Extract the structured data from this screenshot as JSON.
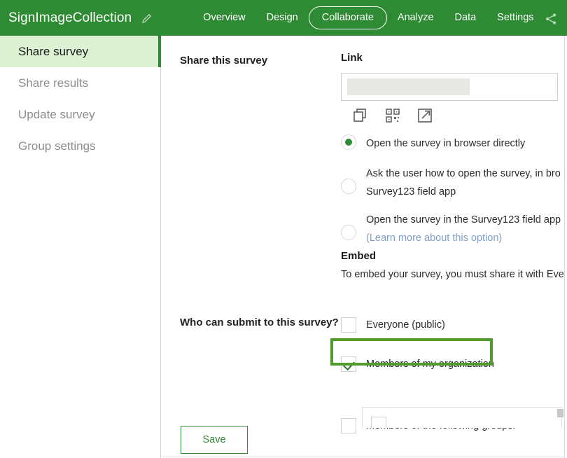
{
  "header": {
    "survey_title": "SignImageCollection",
    "edit_icon": "pencil-icon",
    "share_icon": "share-icon",
    "nav": [
      {
        "label": "Overview",
        "active": false
      },
      {
        "label": "Design",
        "active": false
      },
      {
        "label": "Collaborate",
        "active": true
      },
      {
        "label": "Analyze",
        "active": false
      },
      {
        "label": "Data",
        "active": false
      },
      {
        "label": "Settings",
        "active": false
      }
    ],
    "brand_color": "#2e8b33"
  },
  "sidebar": {
    "items": [
      {
        "label": "Share survey",
        "active": true
      },
      {
        "label": "Share results",
        "active": false
      },
      {
        "label": "Update survey",
        "active": false
      },
      {
        "label": "Group settings",
        "active": false
      }
    ],
    "active_background": "#ddf2d2",
    "active_accent": "#2e8b33"
  },
  "main": {
    "share_section_label": "Share this survey",
    "link": {
      "label": "Link",
      "value": "",
      "redacted": true,
      "icons": [
        {
          "name": "copy-icon"
        },
        {
          "name": "qr-code-icon"
        },
        {
          "name": "open-external-icon"
        }
      ]
    },
    "open_options": [
      {
        "label": "Open the survey in browser directly",
        "selected": true,
        "second_line": ""
      },
      {
        "label": "Ask the user how to open the survey, in bro",
        "selected": false,
        "second_line": "Survey123 field app"
      },
      {
        "label": "Open the survey in the Survey123 field app",
        "selected": false,
        "second_line": "(Learn more about this option)"
      }
    ],
    "embed": {
      "heading": "Embed",
      "description": "To embed your survey, you must share it with Eve"
    },
    "submit_permissions": {
      "label": "Who can submit to this survey?",
      "options": [
        {
          "label": "Everyone (public)",
          "checked": false,
          "highlighted": false
        },
        {
          "label": "Members of my organization",
          "checked": true,
          "highlighted": true
        },
        {
          "label": "Members of the following groups:",
          "checked": false,
          "highlighted": false
        }
      ],
      "highlight_color": "#4f9c2d"
    },
    "save_label": "Save"
  }
}
